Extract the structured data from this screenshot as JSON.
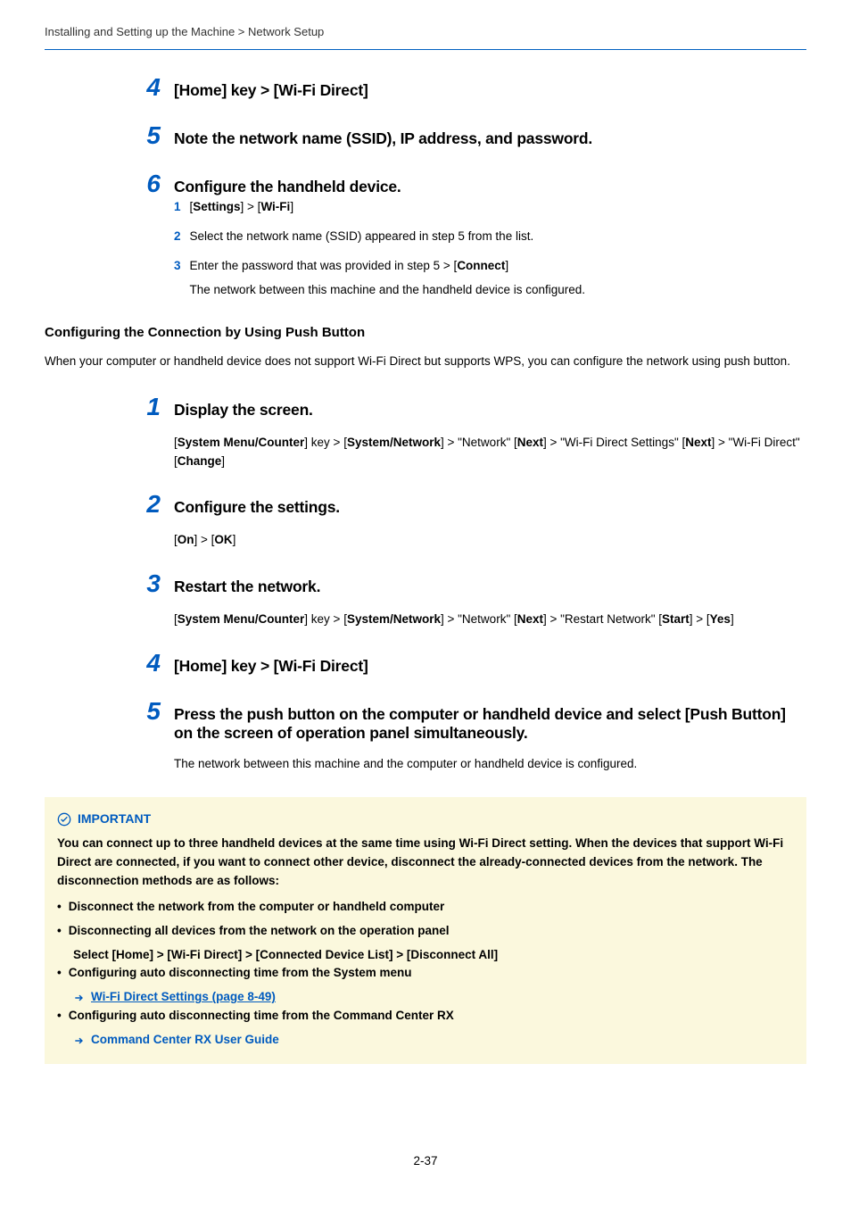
{
  "breadcrumb": "Installing and Setting up the Machine > Network Setup",
  "topSteps": {
    "s4": {
      "num": "4",
      "title_html": "[Home] key > [Wi-Fi Direct]"
    },
    "s5": {
      "num": "5",
      "title": "Note the network name (SSID), IP address, and password."
    },
    "s6": {
      "num": "6",
      "title": "Configure the handheld device.",
      "sub": [
        {
          "n": "1",
          "html": "[<b>Settings</b>] > [<b>Wi-Fi</b>]"
        },
        {
          "n": "2",
          "html": "Select the network name (SSID) appeared in step 5 from the list."
        },
        {
          "n": "3",
          "html": "Enter the password that was provided in step 5 > [<b>Connect</b>]",
          "extra": "The network between this machine and the handheld device is configured."
        }
      ]
    }
  },
  "section2": {
    "heading": "Configuring the Connection by Using Push Button",
    "intro": "When your computer or handheld device does not support Wi-Fi Direct but supports WPS, you can configure the network using push button.",
    "steps": {
      "s1": {
        "num": "1",
        "title": "Display the screen.",
        "body_html": "[<b>System Menu/Counter</b>] key > [<b>System/Network</b>] > \"Network\" [<b>Next</b>] > \"Wi-Fi Direct Settings\" [<b>Next</b>] > \"Wi-Fi Direct\" [<b>Change</b>]"
      },
      "s2": {
        "num": "2",
        "title": "Configure the settings.",
        "body_html": "[<b>On</b>] > [<b>OK</b>]"
      },
      "s3": {
        "num": "3",
        "title": "Restart the network.",
        "body_html": "[<b>System Menu/Counter</b>] key > [<b>System/Network</b>] > \"Network\" [<b>Next</b>] > \"Restart Network\" [<b>Start</b>] > [<b>Yes</b>]"
      },
      "s4": {
        "num": "4",
        "title": "[Home] key > [Wi-Fi Direct]"
      },
      "s5": {
        "num": "5",
        "title": "Press the push button on the computer or handheld device and select [Push Button] on the screen of operation panel simultaneously.",
        "body_plain": "The network between this machine and the computer or handheld device is configured."
      }
    }
  },
  "important": {
    "label": "IMPORTANT",
    "lead": "You can connect up to three handheld devices at the same time using Wi-Fi Direct setting. When the devices that support Wi-Fi Direct are connected, if you want to connect other device, disconnect the already-connected devices from the network. The disconnection methods are as follows:",
    "items": [
      {
        "text": "Disconnect the network from the computer or handheld computer"
      },
      {
        "text": "Disconnecting all devices from the network on the operation panel",
        "plain_sub": "Select [Home] > [Wi-Fi Direct] > [Connected Device List] > [Disconnect All]"
      },
      {
        "text": "Configuring auto disconnecting time from the System menu",
        "link": "Wi-Fi Direct Settings (page 8-49)",
        "link_underline": true
      },
      {
        "text": "Configuring auto disconnecting time from the Command Center RX",
        "link": "Command Center RX User Guide",
        "link_underline": false
      }
    ]
  },
  "pageNumber": "2-37"
}
